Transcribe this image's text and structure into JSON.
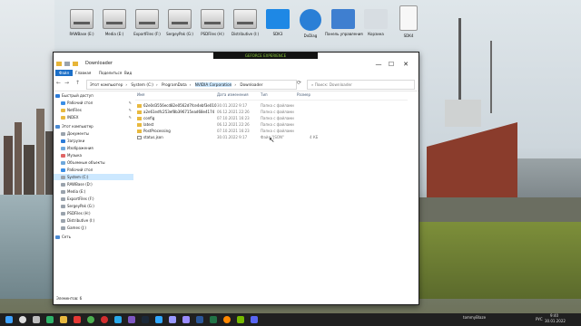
{
  "desktop": {
    "icons": [
      {
        "label": "RAWBase (E:)",
        "kind": "drive"
      },
      {
        "label": "Media (E:)",
        "kind": "drive"
      },
      {
        "label": "ExportFiles (F:)",
        "kind": "drive"
      },
      {
        "label": "SergeyPak (G:)",
        "kind": "drive"
      },
      {
        "label": "PSDFiles (H:)",
        "kind": "drive"
      },
      {
        "label": "Distributive (I:)",
        "kind": "drive"
      },
      {
        "label": "SDK3",
        "kind": "app-blue"
      },
      {
        "label": "DxDiag",
        "kind": "app-refresh"
      },
      {
        "label": "Панель управления",
        "kind": "app-control"
      },
      {
        "label": "Корзина",
        "kind": "recycle"
      },
      {
        "label": "SDK4",
        "kind": "file"
      }
    ]
  },
  "overlay": {
    "gfe": "GEFORCE EXPERIENCE"
  },
  "window": {
    "title": "Downloader",
    "ribbon_tabs": [
      "Файл",
      "Главная",
      "Поделиться",
      "Вид"
    ],
    "address": [
      "Этот компьютер",
      "System (C:)",
      "ProgramData",
      "NVIDIA Corporation",
      "Downloader"
    ],
    "search_placeholder": "Поиск: Downloader",
    "controls": {
      "min": "—",
      "max": "☐",
      "close": "✕",
      "nav": [
        "←",
        "→",
        "↑",
        "⟳"
      ]
    },
    "sidebar": [
      {
        "label": "Быстрый доступ",
        "color": "#2b7bd8",
        "pin": false
      },
      {
        "label": "Рабочий стол",
        "color": "#3a8ee6",
        "pin": true
      },
      {
        "label": "NetFiles",
        "color": "#e8b93f",
        "pin": true
      },
      {
        "label": "INDEX",
        "color": "#e8b93f",
        "pin": true
      },
      {
        "label": "Этот компьютер",
        "color": "#4a8ad2",
        "pin": false
      },
      {
        "label": "Документы",
        "color": "#9aa3ad",
        "pin": false
      },
      {
        "label": "Загрузки",
        "color": "#2b7bd8",
        "pin": false
      },
      {
        "label": "Изображения",
        "color": "#6fa8dc",
        "pin": false
      },
      {
        "label": "Музыка",
        "color": "#e06666",
        "pin": false
      },
      {
        "label": "Объемные объекты",
        "color": "#6fa8dc",
        "pin": false
      },
      {
        "label": "Рабочий стол",
        "color": "#3a8ee6",
        "pin": false
      },
      {
        "label": "System (C:)",
        "color": "#9aa3ad",
        "pin": false,
        "selected": true
      },
      {
        "label": "RAWBase (D:)",
        "color": "#9aa3ad",
        "pin": false
      },
      {
        "label": "Media (E:)",
        "color": "#9aa3ad",
        "pin": false
      },
      {
        "label": "ExportFiles (F:)",
        "color": "#9aa3ad",
        "pin": false
      },
      {
        "label": "SergeyPak (G:)",
        "color": "#9aa3ad",
        "pin": false
      },
      {
        "label": "PSDFiles (H:)",
        "color": "#9aa3ad",
        "pin": false
      },
      {
        "label": "Distributive (I:)",
        "color": "#9aa3ad",
        "pin": false
      },
      {
        "label": "Games (J:)",
        "color": "#9aa3ad",
        "pin": false
      },
      {
        "label": "Сеть",
        "color": "#4a8ad2",
        "pin": false
      }
    ],
    "columns": {
      "name": "Имя",
      "date": "Дата изменения",
      "type": "Тип",
      "size": "Размер"
    },
    "rows": [
      {
        "name": "62e0d3556ecd82e0562d7fce4ebf3e010",
        "date": "30.01.2022 9:17",
        "type": "Папка с файлами",
        "size": "",
        "kind": "folder"
      },
      {
        "name": "a2e61edfc253ef8b396715ead68e4174",
        "date": "06.12.2021 22:26",
        "type": "Папка с файлами",
        "size": "",
        "kind": "folder"
      },
      {
        "name": "config",
        "date": "07.10.2021 16:23",
        "type": "Папка с файлами",
        "size": "",
        "kind": "folder"
      },
      {
        "name": "latest",
        "date": "06.12.2021 22:26",
        "type": "Папка с файлами",
        "size": "",
        "kind": "folder"
      },
      {
        "name": "PostProcessing",
        "date": "07.10.2021 16:23",
        "type": "Папка с файлами",
        "size": "",
        "kind": "folder"
      },
      {
        "name": "status.json",
        "date": "30.01.2022 9:17",
        "type": "Файл \"JSON\"",
        "size": "4 КБ",
        "kind": "file"
      }
    ],
    "status": "Элементов: 6"
  },
  "taskbar": {
    "time": "9:40",
    "date": "30.01.2022",
    "lang": "РУС",
    "user": "tommyBlaze",
    "icons": [
      "windows",
      "search",
      "taskview",
      "edge",
      "explorer",
      "yandex",
      "chrome",
      "opera",
      "telegram",
      "viber",
      "steam",
      "photoshop",
      "premiere",
      "aftereffects",
      "word",
      "excel",
      "vlc",
      "nvidia",
      "discord"
    ]
  }
}
